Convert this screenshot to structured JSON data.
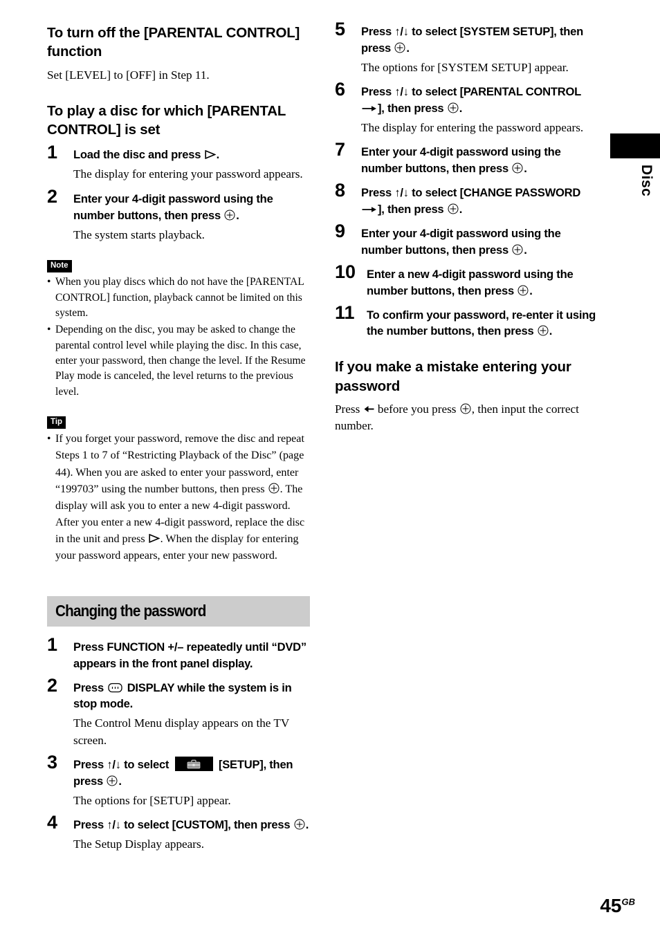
{
  "page": {
    "number": "45",
    "region_code": "GB",
    "side_tab_label": "Disc"
  },
  "left_column": {
    "heading_turn_off": "To turn off the [PARENTAL CONTROL] function",
    "turn_off_body": "Set [LEVEL] to [OFF] in Step 11.",
    "heading_play_disc": "To play a disc for which [PARENTAL CONTROL] is set",
    "steps": [
      {
        "num": "1",
        "instr_before": "Load the disc and press ",
        "icon": "play-icon",
        "instr_after": ".",
        "result": "The display for entering your password appears."
      },
      {
        "num": "2",
        "instr_before": "Enter your 4-digit password using the number buttons, then press ",
        "icon": "enter-icon",
        "instr_after": ".",
        "result": "The system starts playback."
      }
    ],
    "note": {
      "badge": "Note",
      "items": [
        "When you play discs which do not have the [PARENTAL CONTROL] function, playback cannot be limited on this system.",
        "Depending on the disc, you may be asked to change the parental control level while playing the disc. In this case, enter your password, then change the level. If the Resume Play mode is canceled, the level returns to the previous level."
      ]
    },
    "tip": {
      "badge": "Tip",
      "text_part1": "If you forget your password, remove the disc and repeat Steps 1 to 7 of “Restricting Playback of the Disc” (page 44). When you are asked to enter your password, enter “199703” using the number buttons, then press ",
      "icon1": "enter-icon",
      "text_part2": ". The display will ask you to enter a new 4-digit password. After you enter a new 4-digit password, replace the disc in the unit and press ",
      "icon2": "play-icon",
      "text_part3": ". When the display for entering your password appears, enter your new password."
    },
    "section_band_title": "Changing the password",
    "change_steps": [
      {
        "num": "1",
        "instr": "Press FUNCTION +/– repeatedly until “DVD” appears in the front panel display.",
        "result": ""
      },
      {
        "num": "2",
        "instr_before": "Press ",
        "icon": "display-icon",
        "instr_after": " DISPLAY while the system is in stop mode.",
        "result": "The Control Menu display appears on the TV screen."
      },
      {
        "num": "3",
        "instr_before": "Press ↑/↓ to select ",
        "icon": "setup-toolbox-icon",
        "instr_mid": " [SETUP], then press ",
        "icon2": "enter-icon",
        "instr_after": ".",
        "result": "The options for [SETUP] appear."
      },
      {
        "num": "4",
        "instr_before": "Press ↑/↓ to select [CUSTOM], then press ",
        "icon": "enter-icon",
        "instr_after": ".",
        "result": "The Setup Display appears."
      }
    ]
  },
  "right_column": {
    "steps": [
      {
        "num": "5",
        "instr_before": "Press ↑/↓ to select [SYSTEM SETUP], then press ",
        "icon": "enter-icon",
        "instr_after": ".",
        "result": "The options for [SYSTEM SETUP] appear."
      },
      {
        "num": "6",
        "instr_before": "Press ↑/↓ to select [PARENTAL CONTROL ",
        "icon_arrow": "arrow-right-icon",
        "instr_mid": "], then press ",
        "icon": "enter-icon",
        "instr_after": ".",
        "result": "The display for entering the password appears."
      },
      {
        "num": "7",
        "instr_before": "Enter your 4-digit password using the number buttons, then press ",
        "icon": "enter-icon",
        "instr_after": ".",
        "result": ""
      },
      {
        "num": "8",
        "instr_before": "Press ↑/↓ to select [CHANGE PASSWORD ",
        "icon_arrow": "arrow-right-icon",
        "instr_mid": "], then press ",
        "icon": "enter-icon",
        "instr_after": ".",
        "result": ""
      },
      {
        "num": "9",
        "instr_before": "Enter your 4-digit password using the number buttons, then press ",
        "icon": "enter-icon",
        "instr_after": ".",
        "result": ""
      },
      {
        "num": "10",
        "instr_before": "Enter a new 4-digit password using the number buttons, then press ",
        "icon": "enter-icon",
        "instr_after": ".",
        "result": ""
      },
      {
        "num": "11",
        "instr_before": "To confirm your password, re-enter it using the number buttons, then press ",
        "icon": "enter-icon",
        "instr_after": ".",
        "result": ""
      }
    ],
    "heading_mistake": "If you make a mistake entering your password",
    "mistake_part1": "Press ",
    "mistake_icon1": "arrow-left-icon",
    "mistake_part2": " before you press ",
    "mistake_icon2": "enter-icon",
    "mistake_part3": ", then input the correct number."
  },
  "colors": {
    "band_background": "#cccccc",
    "badge_background": "#000000",
    "setup_icon_glyph": "#999999"
  }
}
